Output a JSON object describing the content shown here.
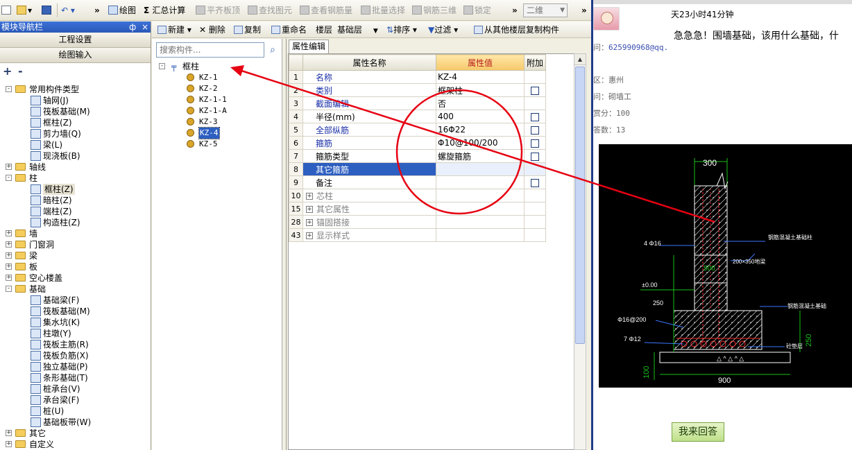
{
  "toolbar": {
    "more1": "»",
    "draw": "绘图",
    "summary": "汇总计算",
    "flat_roof": "平齐板顶",
    "find_element": "查找图元",
    "view_rebar": "查看钢筋量",
    "batch_select": "批量选择",
    "rebar_3d": "钢筋三维",
    "lock": "锁定",
    "more2": "»",
    "view_mode": "二维",
    "more3": "»"
  },
  "nav": {
    "title": "模块导航栏",
    "pin": "ф",
    "close": "×",
    "project_settings": "工程设置",
    "drawing_input": "绘图输入",
    "tools": [
      "+",
      "-"
    ],
    "tree": [
      {
        "level": 0,
        "exp": "-",
        "folder": true,
        "label": "常用构件类型"
      },
      {
        "level": 1,
        "label": "轴网(J)"
      },
      {
        "level": 1,
        "label": "筏板基础(M)"
      },
      {
        "level": 1,
        "label": "框柱(Z)"
      },
      {
        "level": 1,
        "label": "剪力墙(Q)"
      },
      {
        "level": 1,
        "label": "梁(L)"
      },
      {
        "level": 1,
        "label": "现浇板(B)"
      },
      {
        "level": 0,
        "exp": "+",
        "folder": true,
        "label": "轴线"
      },
      {
        "level": 0,
        "exp": "-",
        "folder": true,
        "label": "柱"
      },
      {
        "level": 1,
        "label": "框柱(Z)",
        "selected": true
      },
      {
        "level": 1,
        "label": "暗柱(Z)"
      },
      {
        "level": 1,
        "label": "端柱(Z)"
      },
      {
        "level": 1,
        "label": "构造柱(Z)"
      },
      {
        "level": 0,
        "exp": "+",
        "folder": true,
        "label": "墙"
      },
      {
        "level": 0,
        "exp": "+",
        "folder": true,
        "label": "门窗洞"
      },
      {
        "level": 0,
        "exp": "+",
        "folder": true,
        "label": "梁"
      },
      {
        "level": 0,
        "exp": "+",
        "folder": true,
        "label": "板"
      },
      {
        "level": 0,
        "exp": "+",
        "folder": true,
        "label": "空心楼盖"
      },
      {
        "level": 0,
        "exp": "-",
        "folder": true,
        "label": "基础"
      },
      {
        "level": 1,
        "label": "基础梁(F)"
      },
      {
        "level": 1,
        "label": "筏板基础(M)"
      },
      {
        "level": 1,
        "label": "集水坑(K)"
      },
      {
        "level": 1,
        "label": "柱墩(Y)"
      },
      {
        "level": 1,
        "label": "筏板主筋(R)"
      },
      {
        "level": 1,
        "label": "筏板负筋(X)"
      },
      {
        "level": 1,
        "label": "独立基础(P)"
      },
      {
        "level": 1,
        "label": "条形基础(T)"
      },
      {
        "level": 1,
        "label": "桩承台(V)"
      },
      {
        "level": 1,
        "label": "承台梁(F)"
      },
      {
        "level": 1,
        "label": "桩(U)"
      },
      {
        "level": 1,
        "label": "基础板带(W)"
      },
      {
        "level": 0,
        "exp": "+",
        "folder": true,
        "label": "其它"
      },
      {
        "level": 0,
        "exp": "+",
        "folder": true,
        "label": "自定义"
      }
    ]
  },
  "comp_toolbar": {
    "new": "新建",
    "delete": "删除",
    "copy": "复制",
    "rename": "重命名",
    "floor": "楼层",
    "floor_value": "基础层",
    "sort": "排序",
    "filter": "过滤",
    "copy_from_floor": "从其他楼层复制构件"
  },
  "comp_list": {
    "search_placeholder": "搜索构件...",
    "root": "框柱",
    "root_exp": "-",
    "items": [
      {
        "label": "KZ-1"
      },
      {
        "label": "KZ-2"
      },
      {
        "label": "KZ-1-1"
      },
      {
        "label": "KZ-1-A"
      },
      {
        "label": "KZ-3"
      },
      {
        "label": "KZ-4",
        "selected": true
      },
      {
        "label": "KZ-5"
      }
    ]
  },
  "attr": {
    "tab": "属性编辑",
    "headers": {
      "name": "属性名称",
      "value": "属性值",
      "extra": "附加"
    },
    "rows": [
      {
        "num": "1",
        "name": "名称",
        "value": "KZ-4",
        "check": false
      },
      {
        "num": "2",
        "name": "类别",
        "value": "框架柱",
        "check": true
      },
      {
        "num": "3",
        "name": "截面编辑",
        "value": "否",
        "check": false
      },
      {
        "num": "4",
        "name": "半径(mm)",
        "value": "400",
        "check": true,
        "plain": true
      },
      {
        "num": "5",
        "name": "全部纵筋",
        "value": "16Φ22",
        "check": true
      },
      {
        "num": "6",
        "name": "箍筋",
        "value": "Φ10@100/200",
        "check": true
      },
      {
        "num": "7",
        "name": "箍筋类型",
        "value": "螺旋箍筋",
        "check": true,
        "plain": true
      },
      {
        "num": "8",
        "name": "其它箍筋",
        "value": "",
        "check": false,
        "selected": true
      },
      {
        "num": "9",
        "name": "备注",
        "value": "",
        "check": true,
        "plain": true
      },
      {
        "num": "10",
        "name": "芯柱",
        "value": "",
        "check": false,
        "group": true
      },
      {
        "num": "15",
        "name": "其它属性",
        "value": "",
        "check": false,
        "group": true
      },
      {
        "num": "28",
        "name": "锚固搭接",
        "value": "",
        "check": false,
        "group": true
      },
      {
        "num": "43",
        "name": "显示样式",
        "value": "",
        "check": false,
        "group": true
      }
    ]
  },
  "qa": {
    "time": "天23小时41分钟",
    "question": "急急急！围墙基础，该用什么基础，什",
    "qq_label": "问：",
    "qq": "625990968@qq.",
    "region_label": "区：",
    "region": "惠州",
    "job_label": "问：",
    "job": "砌墙工",
    "score_label": "赏分：",
    "score": "100",
    "answers_label": "答数：",
    "answers": "13",
    "answer_button": "我来回答"
  },
  "cad": {
    "dim_top": "300",
    "rebar_left": "4 Φ16",
    "label_column": "钢筋混凝土基础柱",
    "label_beam": "200×350地梁",
    "level": "±0.00",
    "dim_mid": "500",
    "dim_250": "250",
    "label_footing": "钢筋混凝土基础",
    "rebar_bottom": "Φ16@200",
    "rebar_bottom2": "7 Φ12",
    "label_cushion": "砼垫层",
    "dim_right": "250",
    "dim_left": "100",
    "dim_bottom": "900"
  },
  "colors": {
    "annotation": "#e60012",
    "selection": "#2d5fc1",
    "cad_bg": "#000000"
  }
}
